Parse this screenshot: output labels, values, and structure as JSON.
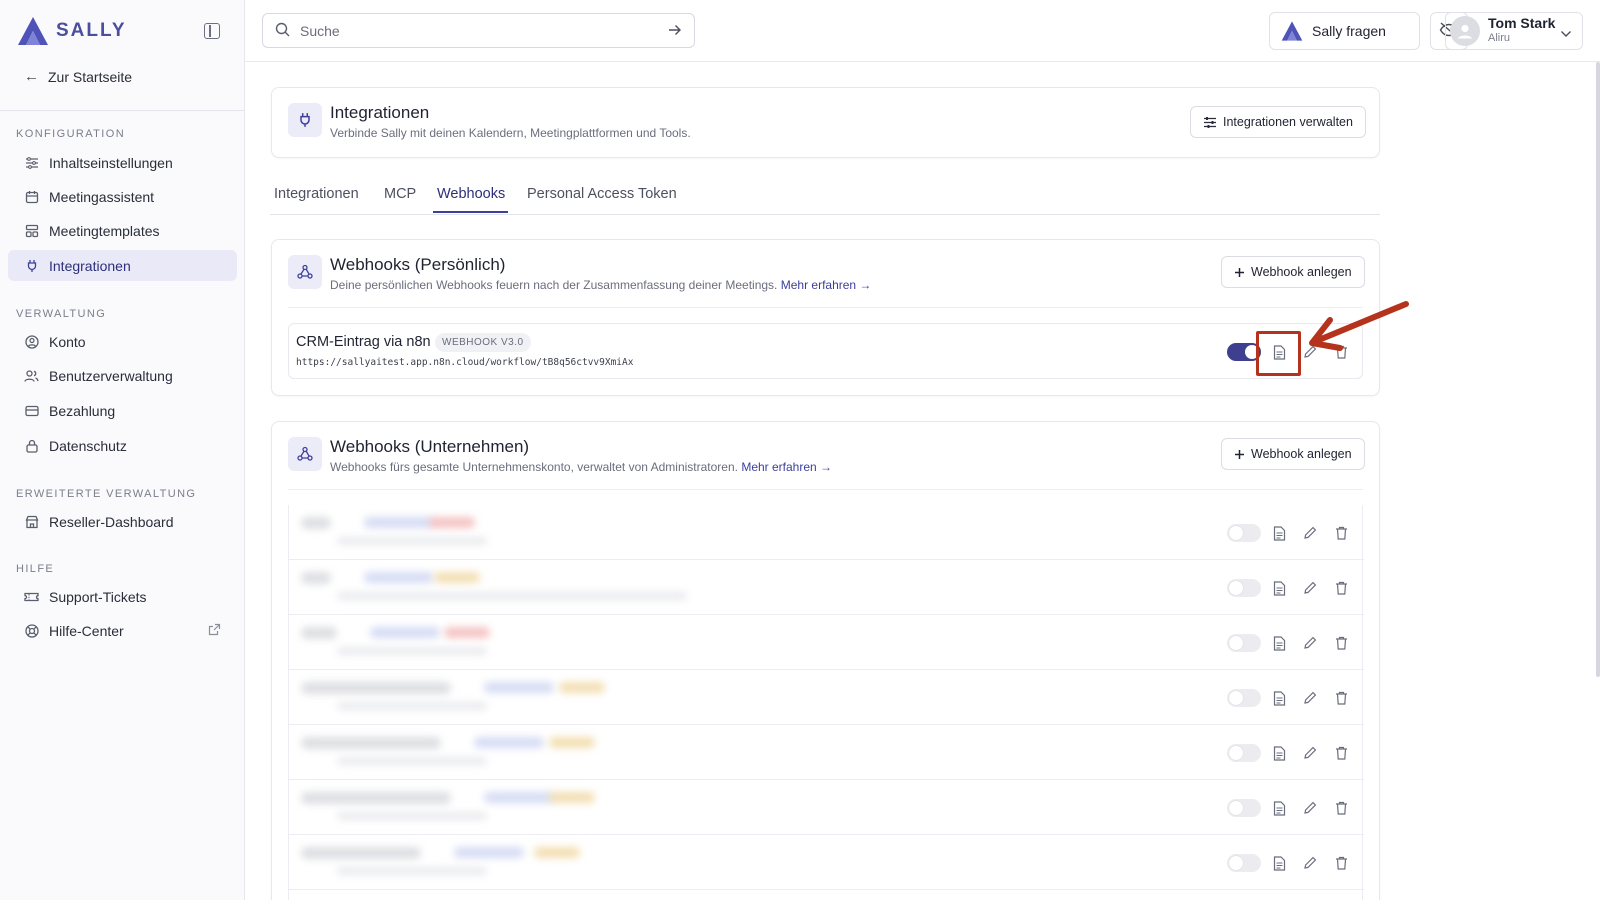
{
  "brand": {
    "name": "SALLY"
  },
  "sidebar": {
    "back_label": "Zur Startseite",
    "sections": [
      {
        "title": "KONFIGURATION",
        "items": [
          {
            "label": "Inhaltseinstellungen",
            "icon": "sliders-icon",
            "active": false
          },
          {
            "label": "Meetingassistent",
            "icon": "calendar-icon",
            "active": false
          },
          {
            "label": "Meetingtemplates",
            "icon": "template-icon",
            "active": false
          },
          {
            "label": "Integrationen",
            "icon": "plug-icon",
            "active": true
          }
        ]
      },
      {
        "title": "VERWALTUNG",
        "items": [
          {
            "label": "Konto",
            "icon": "user-circle-icon",
            "active": false
          },
          {
            "label": "Benutzerverwaltung",
            "icon": "users-icon",
            "active": false
          },
          {
            "label": "Bezahlung",
            "icon": "credit-card-icon",
            "active": false
          },
          {
            "label": "Datenschutz",
            "icon": "lock-icon",
            "active": false
          }
        ]
      },
      {
        "title": "ERWEITERTE VERWALTUNG",
        "items": [
          {
            "label": "Reseller-Dashboard",
            "icon": "store-icon",
            "active": false
          }
        ]
      },
      {
        "title": "HILFE",
        "items": [
          {
            "label": "Support-Tickets",
            "icon": "ticket-icon",
            "active": false
          },
          {
            "label": "Hilfe-Center",
            "icon": "lifebuoy-icon",
            "active": false,
            "external": true
          }
        ]
      }
    ]
  },
  "topbar": {
    "search_placeholder": "Suche",
    "ask_label": "Sally fragen",
    "user": {
      "name": "Tom Stark",
      "org": "Aliru"
    }
  },
  "header_card": {
    "title": "Integrationen",
    "subtitle": "Verbinde Sally mit deinen Kalendern, Meetingplattformen und Tools.",
    "manage_button": "Integrationen verwalten"
  },
  "tabs": [
    {
      "label": "Integrationen",
      "active": false
    },
    {
      "label": "MCP",
      "active": false
    },
    {
      "label": "Webhooks",
      "active": true
    },
    {
      "label": "Personal Access Token",
      "active": false
    }
  ],
  "personal_webhooks": {
    "title": "Webhooks (Persönlich)",
    "subtitle": "Deine persönlichen Webhooks feuern nach der Zusammenfassung deiner Meetings.",
    "learn_more": "Mehr erfahren →",
    "add_button": "Webhook anlegen",
    "items": [
      {
        "name": "CRM-Eintrag via n8n",
        "badge": "WEBHOOK V3.0",
        "url": "https://sallyaitest.app.n8n.cloud/workflow/tB8q56ctvv9XmiAx",
        "enabled": true
      }
    ]
  },
  "company_webhooks": {
    "title": "Webhooks (Unternehmen)",
    "subtitle": "Webhooks fürs gesamte Unternehmenskonto, verwaltet von Administratoren.",
    "learn_more": "Mehr erfahren →",
    "add_button": "Webhook anlegen",
    "rows": [
      {
        "enabled": false
      },
      {
        "enabled": false
      },
      {
        "enabled": false
      },
      {
        "enabled": false
      },
      {
        "enabled": false
      },
      {
        "enabled": false
      },
      {
        "enabled": false
      }
    ]
  },
  "colors": {
    "accent": "#3e3f8e",
    "annotation": "#b5331c",
    "active_bg": "#e9e9f8"
  }
}
